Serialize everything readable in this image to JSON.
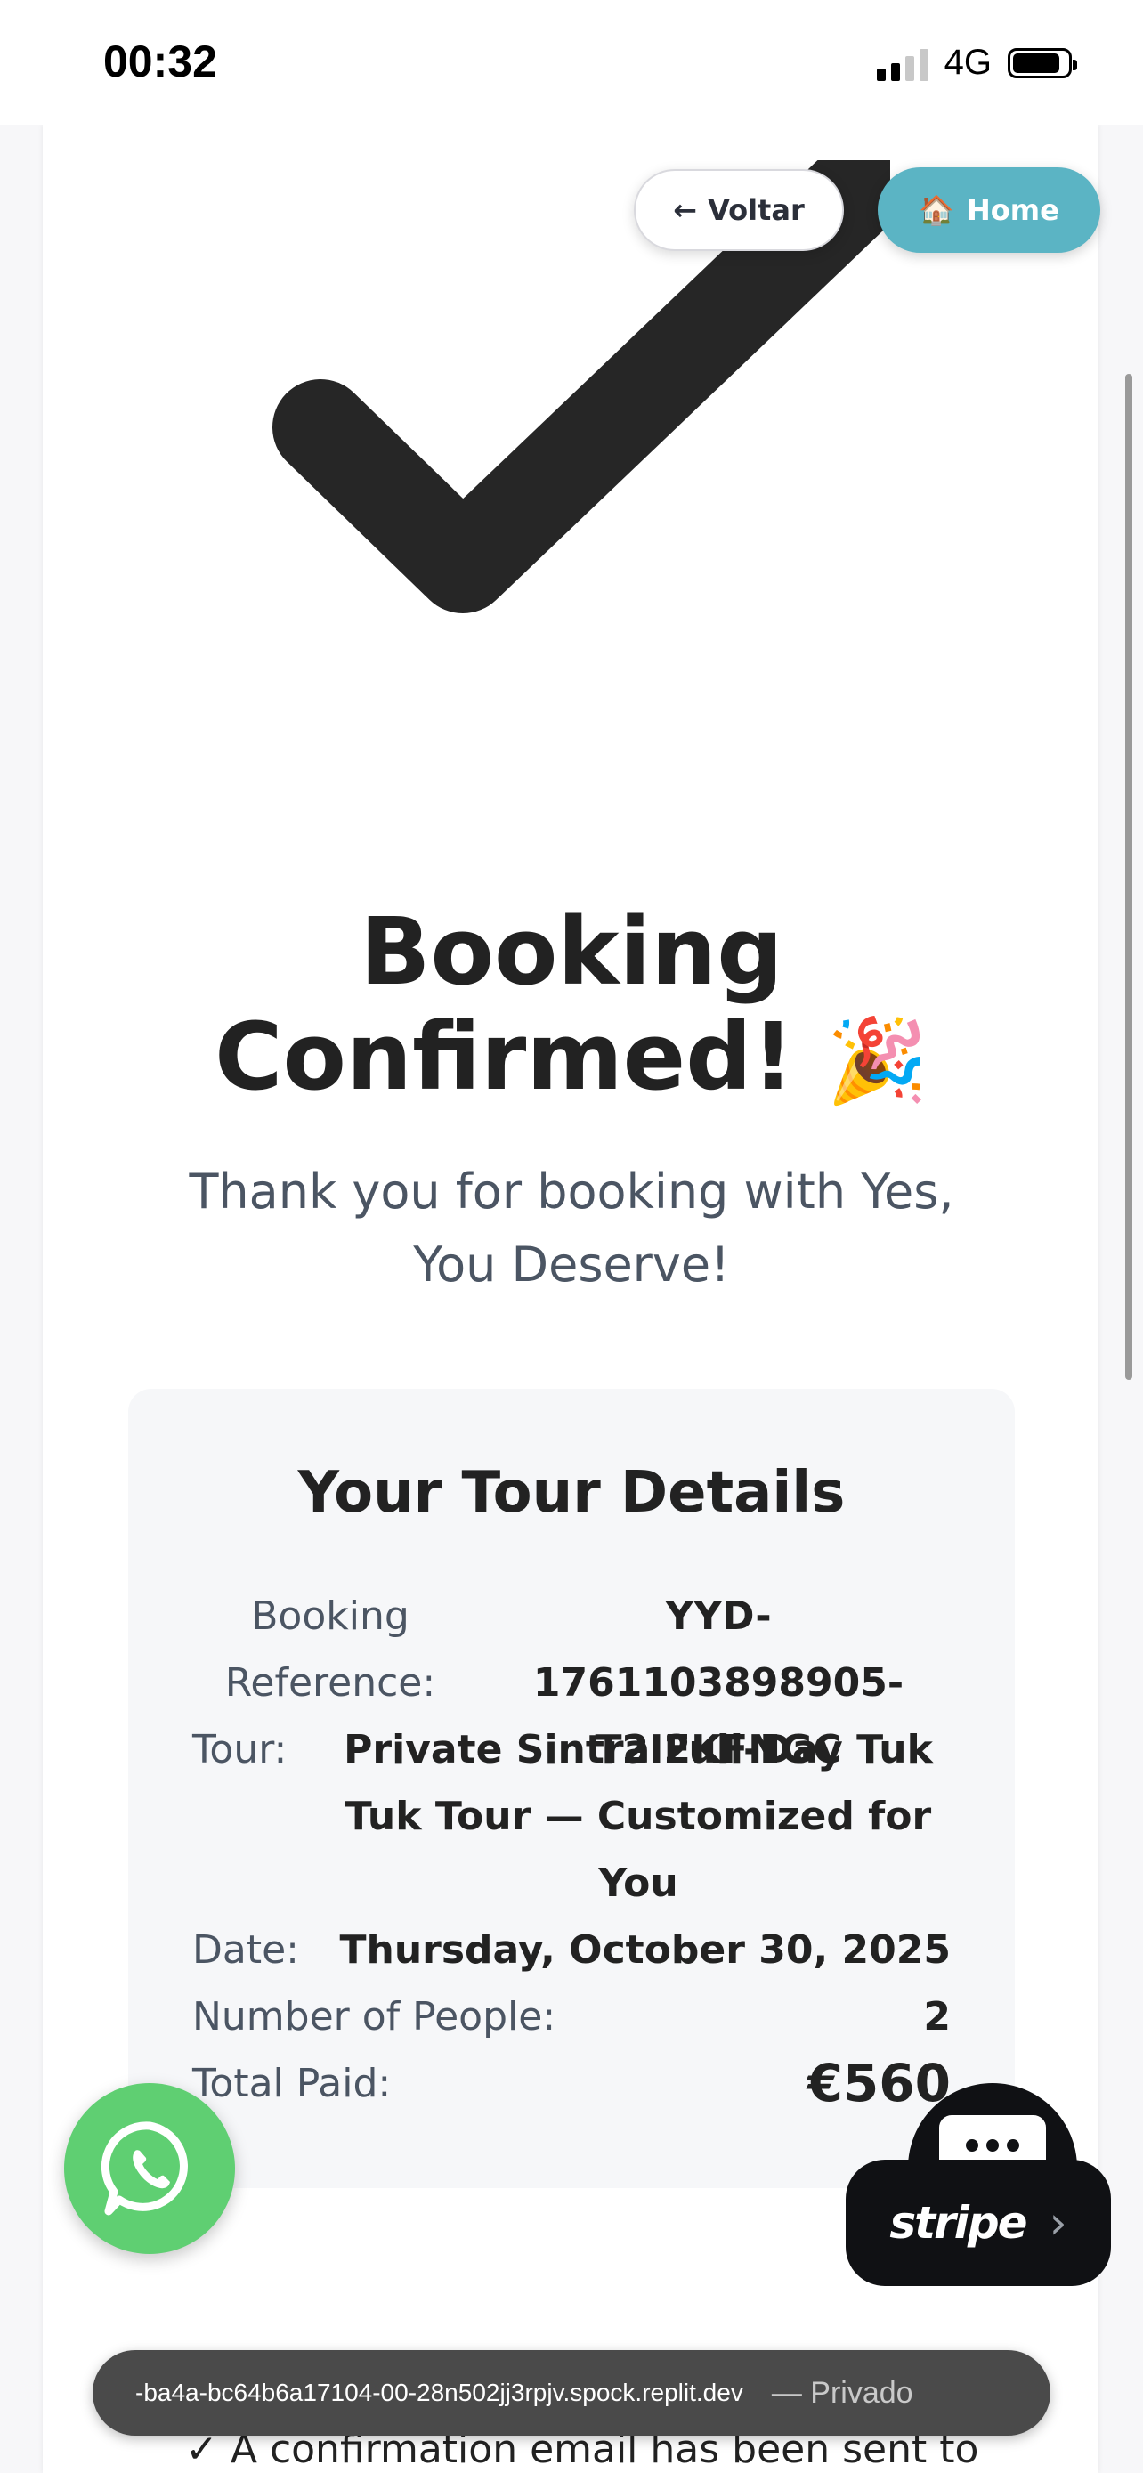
{
  "status_bar": {
    "time": "00:32",
    "network": "4G"
  },
  "nav": {
    "back_label": "Voltar",
    "back_icon": "←",
    "home_label": "Home",
    "home_icon": "🏠"
  },
  "hero": {
    "title_line1": "Booking",
    "title_line2": "Confirmed!",
    "title_emoji": "🎉",
    "subtitle_line1": "Thank you for booking with Yes,",
    "subtitle_line2": "You Deserve!"
  },
  "details": {
    "heading": "Your Tour Details",
    "booking_ref_label_1": "Booking",
    "booking_ref_label_2": "Reference:",
    "booking_ref_value_1": "YYD-1761103898905-",
    "booking_ref_value_2": "T2I2KFNGC",
    "tour_label": "Tour:",
    "tour_value_1": "Private Sintra Full-Day Tuk",
    "tour_value_2": "Tuk Tour — Customized for",
    "tour_value_3": "You",
    "date_label": "Date:",
    "date_value": "Thursday, October 30, 2025",
    "people_label": "Number of People:",
    "people_value": "2",
    "total_label": "Total Paid:",
    "total_value": "€560"
  },
  "widgets": {
    "stripe_label": "stripe",
    "stripe_chevron": "›"
  },
  "confirmation_peek": "✓ A confirmation email has been sent to",
  "browser": {
    "url": "-ba4a-bc64b6a17104-00-28n502jj3rpjv.spock.replit.dev",
    "mode": "— Privado"
  },
  "colors": {
    "home_button": "#5bb4c4",
    "whatsapp": "#5fcf72",
    "stripe": "#101114",
    "details_bg": "#f6f7f9"
  }
}
